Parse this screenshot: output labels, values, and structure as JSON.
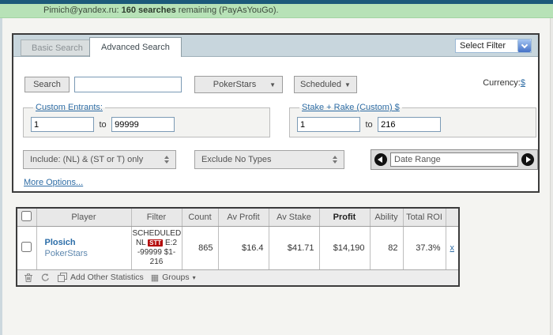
{
  "colors": {
    "top_strip": "#1c5a7a",
    "account_bar_green": "#b7e2b7",
    "link_blue": "#2f6da5",
    "badge_red": "#b40b0b",
    "panel_border": "#3c3c3c"
  },
  "account_bar": {
    "email": "Pimich@yandex.ru:",
    "searches": "160 searches",
    "suffix": "remaining (PayAsYouGo)."
  },
  "tabs": {
    "basic": "Basic Search",
    "advanced": "Advanced Search"
  },
  "filter_select": {
    "value": "Select Filter"
  },
  "search_row": {
    "search_button": "Search",
    "search_value": "",
    "network_select": "PokerStars",
    "schedule_select": "Scheduled",
    "currency_label": "Currency:",
    "currency_link": "$"
  },
  "custom_entrants": {
    "legend": "Custom Entrants:",
    "from": "1",
    "to_word": "to",
    "to": "99999"
  },
  "stake_rake": {
    "legend": "Stake + Rake (Custom) $",
    "from": "1",
    "to_word": "to",
    "to": "216"
  },
  "type_filters": {
    "include": "Include: (NL) & (ST or T) only",
    "exclude": "Exclude No Types",
    "date_range": "Date Range"
  },
  "more_options": "More Options...",
  "results_table": {
    "columns": [
      "Player",
      "Filter",
      "Count",
      "Av Profit",
      "Av Stake",
      "Profit",
      "Ability",
      "Total ROI"
    ],
    "rows": [
      {
        "player_name": "Plosich",
        "player_network": "PokerStars",
        "filter_text_1": "SCHEDULED NL",
        "filter_badge": "STT",
        "filter_text_2": "E:2 -99999 $1-216",
        "count": "865",
        "av_profit": "$16.4",
        "av_stake": "$41.71",
        "profit": "$14,190",
        "ability": "82",
        "total_roi": "37.3%",
        "remove_label": "x"
      }
    ]
  },
  "table_toolbar": {
    "add_other_statistics": "Add Other Statistics",
    "groups": "Groups"
  }
}
